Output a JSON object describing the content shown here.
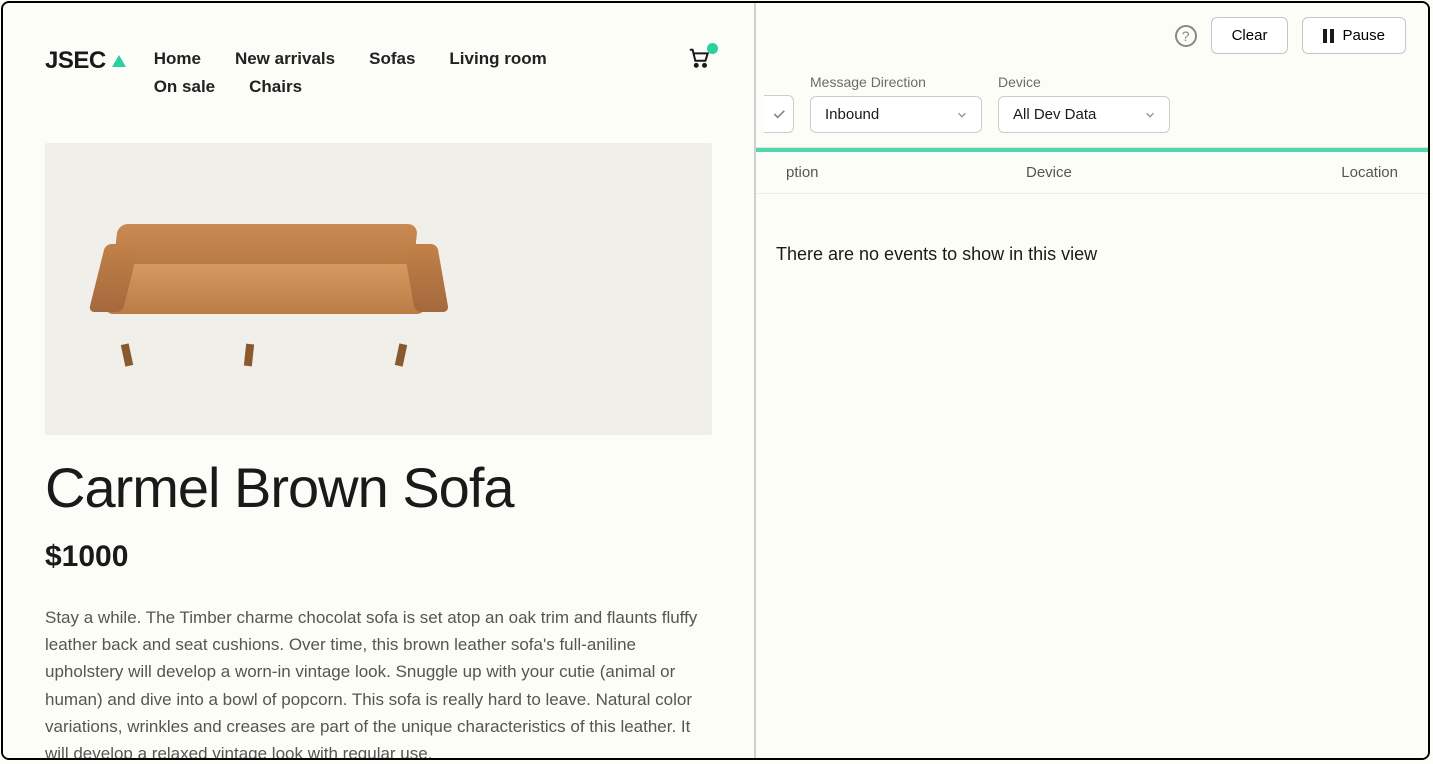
{
  "site": {
    "logo_text": "JSEC",
    "nav": [
      "Home",
      "New arrivals",
      "Sofas",
      "Living room",
      "On sale",
      "Chairs"
    ]
  },
  "product": {
    "title": "Carmel Brown Sofa",
    "price": "$1000",
    "description": "Stay a while. The Timber charme chocolat sofa is set atop an oak trim and flaunts fluffy leather back and seat cushions. Over time, this brown leather sofa's full-aniline upholstery will develop a worn-in vintage look. Snuggle up with your cutie (animal or human) and dive into a bowl of popcorn. This sofa is really hard to leave. Natural color variations, wrinkles and creases are part of the unique characteristics of this leather. It will develop a relaxed vintage look with regular use."
  },
  "tool": {
    "buttons": {
      "clear": "Clear",
      "pause": "Pause"
    },
    "filters": {
      "message_direction": {
        "label": "Message Direction",
        "value": "Inbound"
      },
      "device": {
        "label": "Device",
        "value": "All Dev Data"
      }
    },
    "columns": {
      "option": "ption",
      "device": "Device",
      "location": "Location"
    },
    "empty": "There are no events to show in this view"
  }
}
